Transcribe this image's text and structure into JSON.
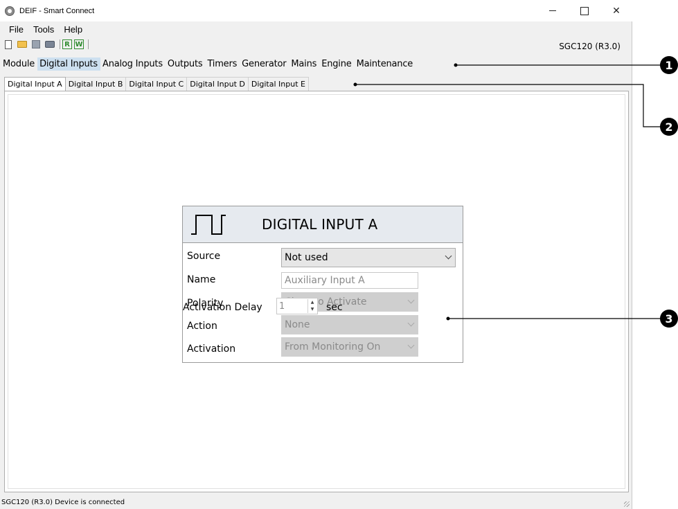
{
  "window": {
    "title": "DEIF - Smart Connect",
    "icon": "deif-logo-icon"
  },
  "menu": {
    "items": [
      "File",
      "Tools",
      "Help"
    ]
  },
  "toolbar": {
    "read_label": "R",
    "write_label": "W",
    "device": "SGC120 (R3.0)"
  },
  "sections": {
    "items": [
      "Module",
      "Digital Inputs",
      "Analog Inputs",
      "Outputs",
      "Timers",
      "Generator",
      "Mains",
      "Engine",
      "Maintenance"
    ],
    "active": "Digital Inputs"
  },
  "tabs": {
    "items": [
      "Digital Input A",
      "Digital Input B",
      "Digital Input C",
      "Digital Input D",
      "Digital Input E"
    ],
    "active": "Digital Input A"
  },
  "card": {
    "title": "DIGITAL INPUT A",
    "icon": "pulse-wave-icon",
    "fields": {
      "source_label": "Source",
      "source_value": "Not used",
      "name_label": "Name",
      "name_value": "Auxiliary Input A",
      "polarity_label": "Polarity",
      "polarity_value": "Close to Activate",
      "action_label": "Action",
      "action_value": "None",
      "activation_label": "Activation",
      "activation_value": "From Monitoring On",
      "delay_label": "Activation Delay",
      "delay_value": "1",
      "delay_unit": "sec"
    }
  },
  "status": {
    "text": "SGC120 (R3.0) Device is connected"
  },
  "callouts": {
    "one": "1",
    "two": "2",
    "three": "3"
  },
  "colors": {
    "active_section_bg": "#cde0f0",
    "card_header_bg": "#e6eaef",
    "rw_green": "#2e8b2e",
    "callout_black": "#000000"
  }
}
